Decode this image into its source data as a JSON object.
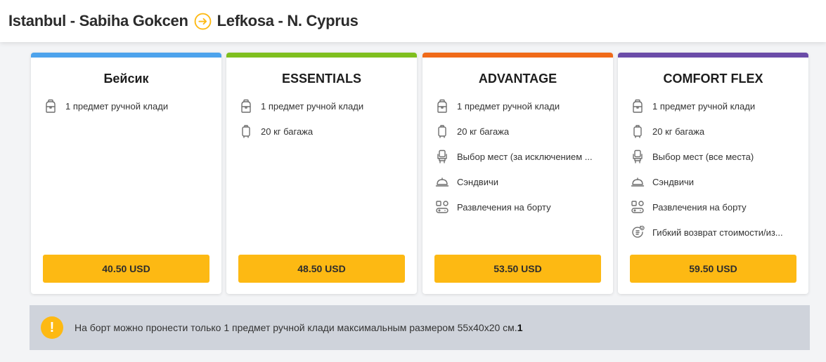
{
  "route": {
    "origin": "Istanbul - Sabiha Gokcen",
    "destination": "Lefkosa - N. Cyprus",
    "accent_color": "#fdb913"
  },
  "fares": [
    {
      "name": "Бейсик",
      "color": "#4da3ec",
      "price": "40.50 USD",
      "features": [
        {
          "icon": "backpack-icon",
          "label": "1 предмет ручной клади"
        }
      ]
    },
    {
      "name": "ESSENTIALS",
      "color": "#7fbf1f",
      "price": "48.50 USD",
      "features": [
        {
          "icon": "backpack-icon",
          "label": "1 предмет ручной клади"
        },
        {
          "icon": "suitcase-icon",
          "label": "20 кг багажа"
        }
      ]
    },
    {
      "name": "ADVANTAGE",
      "color": "#f06a19",
      "price": "53.50 USD",
      "features": [
        {
          "icon": "backpack-icon",
          "label": "1 предмет ручной клади"
        },
        {
          "icon": "suitcase-icon",
          "label": "20 кг багажа"
        },
        {
          "icon": "seat-icon",
          "label": "Выбор мест (за исключением ..."
        },
        {
          "icon": "meal-cloche-icon",
          "label": "Сэндвичи"
        },
        {
          "icon": "entertainment-icon",
          "label": "Развлечения на борту"
        }
      ]
    },
    {
      "name": "COMFORT FLEX",
      "color": "#6b4ca8",
      "price": "59.50 USD",
      "features": [
        {
          "icon": "backpack-icon",
          "label": "1 предмет ручной клади"
        },
        {
          "icon": "suitcase-icon",
          "label": "20 кг багажа"
        },
        {
          "icon": "seat-icon",
          "label": "Выбор мест (все места)"
        },
        {
          "icon": "meal-cloche-icon",
          "label": "Сэндвичи"
        },
        {
          "icon": "entertainment-icon",
          "label": "Развлечения на борту"
        },
        {
          "icon": "refund-icon",
          "label": "Гибкий возврат стоимости/из..."
        }
      ]
    }
  ],
  "notice": {
    "icon": "exclamation-icon",
    "symbol": "!",
    "text": "На борт можно пронести только 1 предмет ручной клади максимальным размером 55x40x20 см.",
    "footnote": "1"
  }
}
